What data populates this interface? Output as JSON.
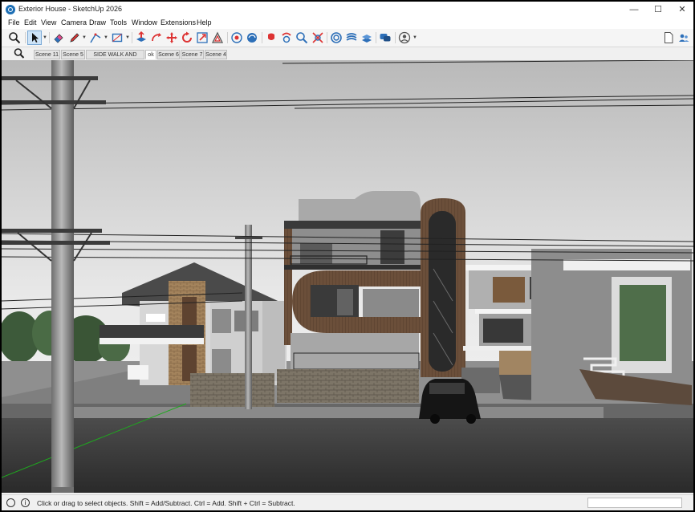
{
  "window": {
    "title": "Exterior House - SketchUp 2026",
    "minimize_glyph": "—",
    "maximize_glyph": "☐",
    "close_glyph": "✕"
  },
  "menu": [
    "File",
    "Edit",
    "View",
    "Camera",
    "Draw",
    "Tools",
    "Window",
    "Extensions",
    "Help"
  ],
  "toolbar": {
    "icons": [
      "search-icon",
      "select-icon",
      "eraser-icon",
      "pencil-icon",
      "line-icon",
      "rectangle-icon",
      "push-pull-icon",
      "follow-me-icon",
      "move-icon",
      "rotate-icon",
      "scale-icon",
      "offset-icon",
      "paint-bucket-icon",
      "orbit-icon",
      "pan-icon",
      "walk-icon",
      "zoom-icon",
      "zoom-extents-icon",
      "scene-icon",
      "layers-icon",
      "sandbox-icon",
      "chat-icon",
      "profile-icon",
      "new-document-icon",
      "user-icon"
    ]
  },
  "scenes": {
    "search_icon": "search-icon",
    "tabs": [
      "Scene 11",
      "Scene 5",
      "SIDE WALK AND ROAD",
      "ok",
      "Scene 6",
      "Scene 7",
      "Scene 4"
    ],
    "active": "ok"
  },
  "status": {
    "text": "Click or drag to select objects. Shift = Add/Subtract. Ctrl = Add. Shift + Ctrl = Subtract.",
    "icons": [
      "geo-location-icon",
      "info-icon"
    ],
    "info_glyph": "i"
  },
  "colors": {
    "accent": "#1d6fb5",
    "sky": "#d9d9d9",
    "road": "#3f3f3f",
    "wood": "#6b4f3a",
    "concrete": "#9a9a9a",
    "glass": "#2a2a2a",
    "tree": "#3d5a3a"
  }
}
